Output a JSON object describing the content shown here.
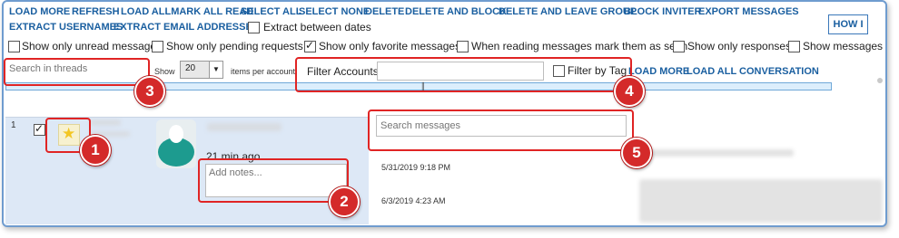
{
  "toolbar": {
    "row1": [
      "LOAD MORE",
      "REFRESH",
      "LOAD ALLMARK ALL READ",
      "SELECT ALL",
      "SELECT NONE",
      "DELETE",
      "DELETE AND BLOCK",
      "DELETE AND LEAVE GROUP",
      "BLOCK INVITER",
      "EXPORT MESSAGES"
    ],
    "row2": [
      "EXTRACT USERNAMES",
      "EXTRACT EMAIL ADDRESSES"
    ],
    "extract_between_dates": "Extract between dates",
    "how_button": "HOW I"
  },
  "options": [
    {
      "label": "Show only unread messages",
      "checked": false
    },
    {
      "label": "Show only pending requests",
      "checked": false
    },
    {
      "label": "Show only favorite messages",
      "checked": true
    },
    {
      "label": "When reading messages mark them as seen",
      "checked": false
    },
    {
      "label": "Show only responses",
      "checked": false
    },
    {
      "label": "Show messages wa",
      "checked": false
    }
  ],
  "filters": {
    "search_threads_placeholder": "Search in threads",
    "show_label": "Show",
    "show_value": "20",
    "items_per_account": "items per account",
    "filter_accounts_label": "Filter Accounts:",
    "filter_by_tag": "Filter by Tag",
    "load_more": "LOAD MORE",
    "load_all_conversation": "LOAD ALL CONVERSATION"
  },
  "thread": {
    "index": "1",
    "time_ago": "21 min ago",
    "notes_placeholder": "Add notes...",
    "favorite": true,
    "checked": true
  },
  "messages": {
    "search_placeholder": "Search messages",
    "dates": [
      "5/31/2019 9:18 PM",
      "6/3/2019 4:23 AM"
    ]
  },
  "callouts": [
    "1",
    "2",
    "3",
    "4",
    "5"
  ],
  "colors": {
    "link": "#1a5fa0",
    "callout": "#d42a2a",
    "row_highlight": "#dde8f6",
    "star": "#f3c623"
  }
}
